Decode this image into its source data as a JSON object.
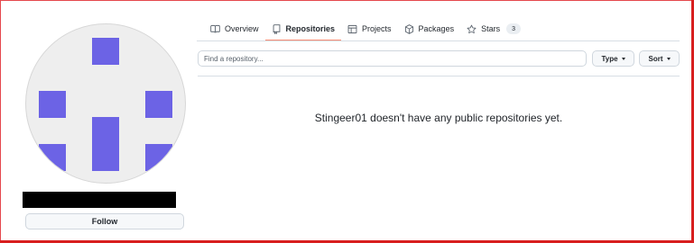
{
  "profile": {
    "follow_label": "Follow"
  },
  "tabs": [
    {
      "label": "Overview",
      "icon": "book-icon"
    },
    {
      "label": "Repositories",
      "icon": "repo-icon",
      "active": true
    },
    {
      "label": "Projects",
      "icon": "table-icon"
    },
    {
      "label": "Packages",
      "icon": "package-icon"
    },
    {
      "label": "Stars",
      "icon": "star-icon",
      "count": "3"
    }
  ],
  "search": {
    "placeholder": "Find a repository..."
  },
  "filters": {
    "type_label": "Type",
    "sort_label": "Sort"
  },
  "empty_message": "Stingeer01 doesn't have any public repositories yet.",
  "colors": {
    "avatar_block": "#6c63e5",
    "active_tab_underline": "#fd8c73",
    "frame": "#d81e1e"
  }
}
